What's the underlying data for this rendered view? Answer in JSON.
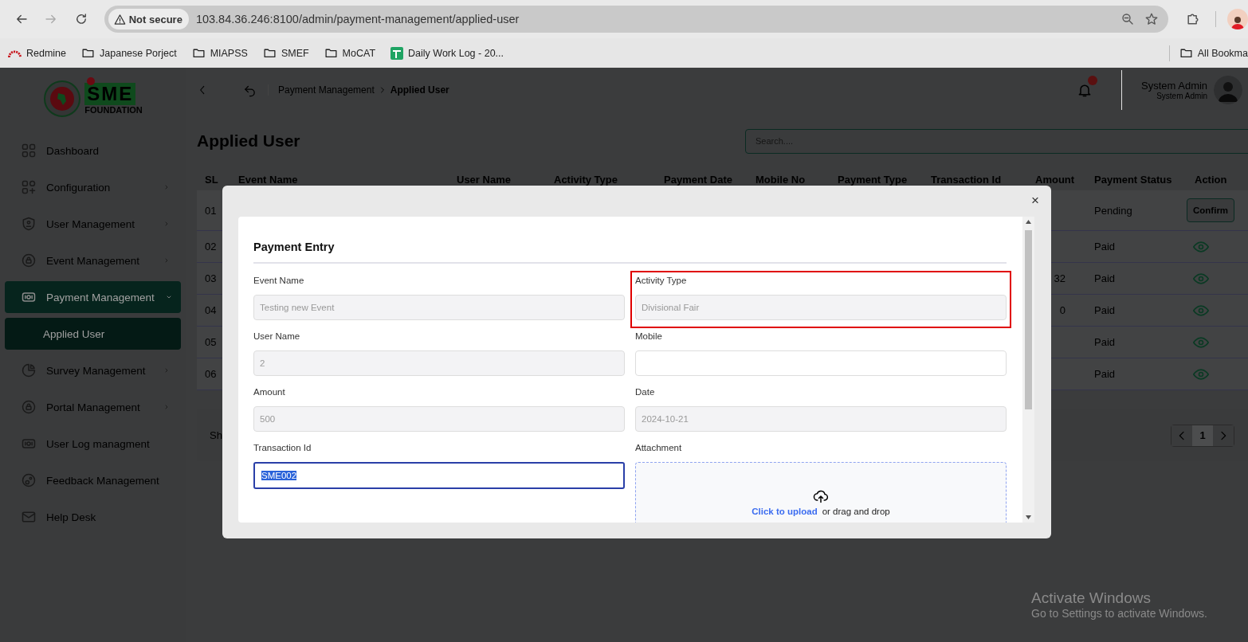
{
  "browser": {
    "security_chip": "Not secure",
    "url": "103.84.36.246:8100/admin/payment-management/applied-user",
    "bookmarks": [
      {
        "label": "Redmine",
        "kind": "redmine"
      },
      {
        "label": "Japanese Porject",
        "kind": "folder"
      },
      {
        "label": "MIAPSS",
        "kind": "folder"
      },
      {
        "label": "SMEF",
        "kind": "folder"
      },
      {
        "label": "MoCAT",
        "kind": "folder"
      },
      {
        "label": "Daily Work Log - 20...",
        "kind": "sheet"
      }
    ],
    "all_bookmarks": "All Bookma"
  },
  "logo": {
    "mark": "SME",
    "caption": "FOUNDATION"
  },
  "sidebar": {
    "items": [
      {
        "label": "Dashboard",
        "kind": "grid",
        "submenu": false,
        "selected": false
      },
      {
        "label": "Configuration",
        "kind": "config",
        "submenu": true,
        "expanded": false,
        "selected": false
      },
      {
        "label": "User Management",
        "kind": "shield",
        "submenu": true,
        "expanded": false,
        "selected": false
      },
      {
        "label": "Event Management",
        "kind": "lock",
        "submenu": true,
        "expanded": false,
        "selected": false
      },
      {
        "label": "Payment Management",
        "kind": "money",
        "submenu": true,
        "expanded": true,
        "selected": true,
        "children": [
          {
            "label": "Applied User",
            "selected": true
          }
        ]
      },
      {
        "label": "Survey Management",
        "kind": "pie",
        "submenu": true,
        "expanded": false,
        "selected": false
      },
      {
        "label": "Portal Management",
        "kind": "lock",
        "submenu": true,
        "expanded": false,
        "selected": false
      },
      {
        "label": "User Log managment",
        "kind": "money",
        "submenu": false,
        "selected": false
      },
      {
        "label": "Feedback Management",
        "kind": "feedback",
        "submenu": false,
        "selected": false
      },
      {
        "label": "Help Desk",
        "kind": "mail",
        "submenu": false,
        "selected": false
      }
    ]
  },
  "breadcrumb": [
    {
      "label": "Payment Management",
      "current": false
    },
    {
      "label": "Applied User",
      "current": true
    }
  ],
  "user": {
    "name": "System Admin",
    "role": "System Admin"
  },
  "page_title": "Applied User",
  "search": {
    "placeholder": "Search...."
  },
  "table": {
    "columns": [
      "SL",
      "Event Name",
      "User Name",
      "Activity Type",
      "Payment Date",
      "Mobile No",
      "Payment Type",
      "Transaction Id",
      "Amount",
      "Payment Status",
      "Action"
    ],
    "rows": [
      {
        "sl": "01",
        "status": "Pending",
        "action": {
          "kind": "button",
          "label": "Confirm"
        }
      },
      {
        "sl": "02",
        "status": "Paid",
        "action": {
          "kind": "view"
        }
      },
      {
        "sl": "03",
        "amount": "32",
        "status": "Paid",
        "action": {
          "kind": "view"
        }
      },
      {
        "sl": "04",
        "amount": "0",
        "status": "Paid",
        "action": {
          "kind": "view"
        }
      },
      {
        "sl": "05",
        "status": "Paid",
        "action": {
          "kind": "view"
        }
      },
      {
        "sl": "06",
        "status": "Paid",
        "action": {
          "kind": "view"
        }
      }
    ]
  },
  "footer": {
    "text": "Sh",
    "pages": [
      {
        "label": "1",
        "selected": true
      }
    ]
  },
  "modal": {
    "title": "Payment Entry",
    "close": "×",
    "fields": [
      {
        "kind": "input",
        "label": "Event Name",
        "value": "Testing new Event",
        "disabled": true,
        "focused": false
      },
      {
        "kind": "input",
        "label": "Activity Type",
        "value": "Divisional Fair",
        "disabled": true,
        "focused": false,
        "highlighted": true
      },
      {
        "kind": "input",
        "label": "User Name",
        "value": "2",
        "disabled": true,
        "focused": false
      },
      {
        "kind": "input",
        "label": "Mobile",
        "disabled": false,
        "focused": false
      },
      {
        "kind": "input",
        "label": "Amount",
        "value": "500",
        "disabled": true,
        "focused": false
      },
      {
        "kind": "input",
        "label": "Date",
        "value": "2024-10-21",
        "disabled": true,
        "focused": false
      },
      {
        "kind": "input",
        "label": "Transaction Id",
        "value": "SME002",
        "disabled": false,
        "focused": true
      },
      {
        "kind": "upload",
        "label": "Attachment",
        "link": "Click to upload",
        "text": "or drag and drop"
      }
    ]
  },
  "os_notice": {
    "title": "Activate Windows",
    "text": "Go to Settings to activate Windows."
  }
}
